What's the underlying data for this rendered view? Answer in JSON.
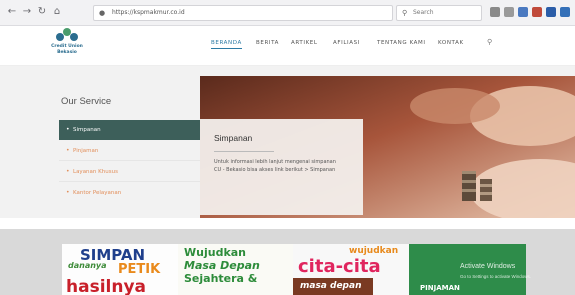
{
  "browser": {
    "url": "https://kspmakmur.co.id",
    "search_placeholder": "Search",
    "back_icon": "arrow-left-icon",
    "forward_icon": "arrow-right-icon",
    "reload_icon": "reload-icon",
    "home_icon": "home-icon"
  },
  "brand": {
    "line1": "Credit Union",
    "line2": "Bekasio",
    "color": "#2b6d8f"
  },
  "nav": {
    "items": [
      "BERANDA",
      "BERITA",
      "ARTIKEL",
      "AFILIASI",
      "TENTANG KAMI",
      "KONTAK"
    ],
    "active": "BERANDA",
    "active_color": "#2c7aa4"
  },
  "service": {
    "title": "Our Service",
    "items": [
      {
        "label": "Simpanan",
        "active": true
      },
      {
        "label": "Pinjaman",
        "active": false
      },
      {
        "label": "Layanan Khusus",
        "active": false
      },
      {
        "label": "Kantor Pelayanan",
        "active": false
      }
    ],
    "active_bg": "#3d5f5a",
    "link_color": "#e28f5b"
  },
  "card": {
    "title": "Simpanan",
    "desc_line1": "Untuk informasi lebih lanjut mengenai simpanan",
    "desc_line2": "CU - Bekasio bisa akses link berikut > Simpanan"
  },
  "banner": {
    "t1": "SIMPAN",
    "t2": "dananya",
    "t3": "PETIK",
    "t4": "hasilnya",
    "t5": "Wujudkan",
    "t6": "Masa Depan",
    "t7": "Sejahtera &",
    "t8": "wujudkan",
    "t9": "cita-cita",
    "t10": "masa depan",
    "t11": "PINJAMAN"
  },
  "watermark": {
    "title": "Activate Windows",
    "sub": "Go to Settings to activate Windows."
  }
}
